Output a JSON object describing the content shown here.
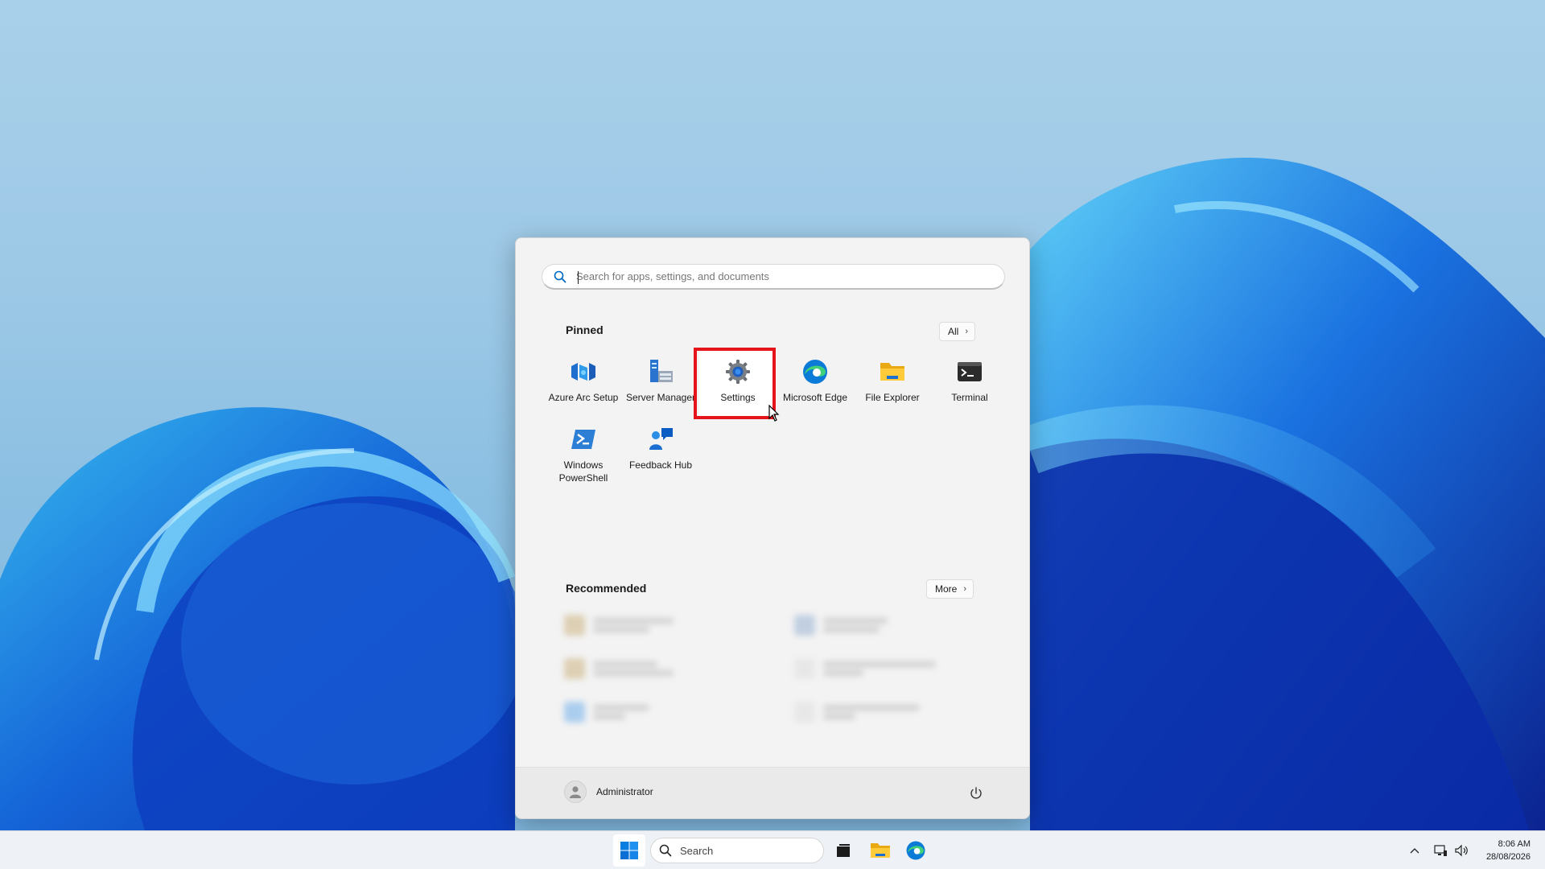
{
  "start_menu": {
    "search": {
      "placeholder": "Search for apps, settings, and documents"
    },
    "pinned": {
      "title": "Pinned",
      "all_label": "All",
      "apps": [
        {
          "label": "Azure Arc Setup",
          "icon": "azure-arc-icon"
        },
        {
          "label": "Server Manager",
          "icon": "server-manager-icon"
        },
        {
          "label": "Settings",
          "icon": "gear-icon"
        },
        {
          "label": "Microsoft Edge",
          "icon": "edge-icon"
        },
        {
          "label": "File Explorer",
          "icon": "folder-icon"
        },
        {
          "label": "Terminal",
          "icon": "terminal-icon"
        },
        {
          "label": "Windows PowerShell",
          "icon": "powershell-icon"
        },
        {
          "label": "Feedback Hub",
          "icon": "feedback-hub-icon"
        }
      ]
    },
    "recommended": {
      "title": "Recommended",
      "more_label": "More"
    },
    "user": {
      "name": "Administrator"
    }
  },
  "taskbar": {
    "search_label": "Search",
    "clock": {
      "time": "8:06 AM",
      "date": "28/08/2026"
    }
  },
  "colors": {
    "highlight": "#e5141a",
    "accent": "#0067c0"
  }
}
